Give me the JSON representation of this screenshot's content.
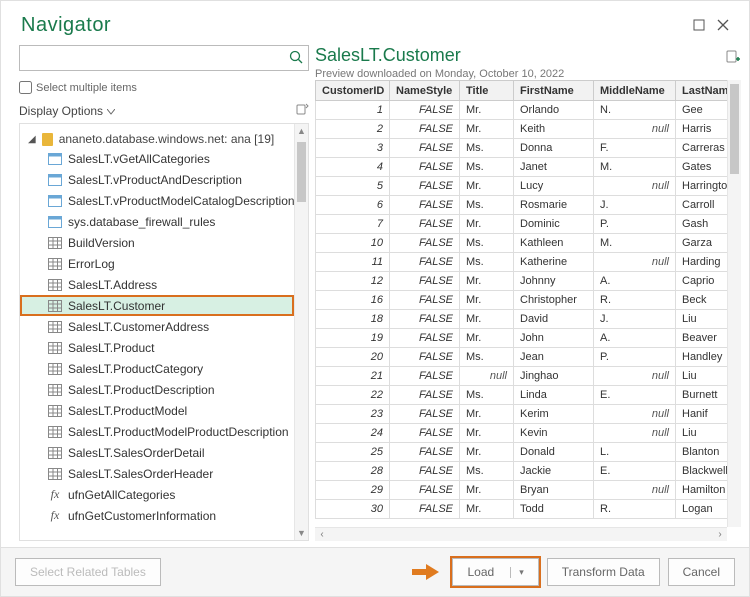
{
  "window": {
    "title": "Navigator"
  },
  "left": {
    "search_placeholder": "",
    "select_multiple": "Select multiple items",
    "display_options": "Display Options",
    "root": {
      "label": "ananeto.database.windows.net: ana [19]"
    },
    "items": [
      {
        "icon": "view",
        "label": "SalesLT.vGetAllCategories"
      },
      {
        "icon": "view",
        "label": "SalesLT.vProductAndDescription"
      },
      {
        "icon": "view",
        "label": "SalesLT.vProductModelCatalogDescription"
      },
      {
        "icon": "view",
        "label": "sys.database_firewall_rules"
      },
      {
        "icon": "table",
        "label": "BuildVersion"
      },
      {
        "icon": "table",
        "label": "ErrorLog"
      },
      {
        "icon": "table",
        "label": "SalesLT.Address"
      },
      {
        "icon": "table",
        "label": "SalesLT.Customer",
        "selected": true
      },
      {
        "icon": "table",
        "label": "SalesLT.CustomerAddress"
      },
      {
        "icon": "table",
        "label": "SalesLT.Product"
      },
      {
        "icon": "table",
        "label": "SalesLT.ProductCategory"
      },
      {
        "icon": "table",
        "label": "SalesLT.ProductDescription"
      },
      {
        "icon": "table",
        "label": "SalesLT.ProductModel"
      },
      {
        "icon": "table",
        "label": "SalesLT.ProductModelProductDescription"
      },
      {
        "icon": "table",
        "label": "SalesLT.SalesOrderDetail"
      },
      {
        "icon": "table",
        "label": "SalesLT.SalesOrderHeader"
      },
      {
        "icon": "fx",
        "label": "ufnGetAllCategories"
      },
      {
        "icon": "fx",
        "label": "ufnGetCustomerInformation"
      }
    ]
  },
  "right": {
    "title": "SalesLT.Customer",
    "subtitle": "Preview downloaded on Monday, October 10, 2022",
    "columns": [
      "CustomerID",
      "NameStyle",
      "Title",
      "FirstName",
      "MiddleName",
      "LastName"
    ],
    "rows": [
      {
        "id": 1,
        "ns": "FALSE",
        "t": "Mr.",
        "fn": "Orlando",
        "mn": "N.",
        "ln": "Gee"
      },
      {
        "id": 2,
        "ns": "FALSE",
        "t": "Mr.",
        "fn": "Keith",
        "mn": null,
        "ln": "Harris"
      },
      {
        "id": 3,
        "ns": "FALSE",
        "t": "Ms.",
        "fn": "Donna",
        "mn": "F.",
        "ln": "Carreras"
      },
      {
        "id": 4,
        "ns": "FALSE",
        "t": "Ms.",
        "fn": "Janet",
        "mn": "M.",
        "ln": "Gates"
      },
      {
        "id": 5,
        "ns": "FALSE",
        "t": "Mr.",
        "fn": "Lucy",
        "mn": null,
        "ln": "Harringto"
      },
      {
        "id": 6,
        "ns": "FALSE",
        "t": "Ms.",
        "fn": "Rosmarie",
        "mn": "J.",
        "ln": "Carroll"
      },
      {
        "id": 7,
        "ns": "FALSE",
        "t": "Mr.",
        "fn": "Dominic",
        "mn": "P.",
        "ln": "Gash"
      },
      {
        "id": 10,
        "ns": "FALSE",
        "t": "Ms.",
        "fn": "Kathleen",
        "mn": "M.",
        "ln": "Garza"
      },
      {
        "id": 11,
        "ns": "FALSE",
        "t": "Ms.",
        "fn": "Katherine",
        "mn": null,
        "ln": "Harding"
      },
      {
        "id": 12,
        "ns": "FALSE",
        "t": "Mr.",
        "fn": "Johnny",
        "mn": "A.",
        "ln": "Caprio"
      },
      {
        "id": 16,
        "ns": "FALSE",
        "t": "Mr.",
        "fn": "Christopher",
        "mn": "R.",
        "ln": "Beck"
      },
      {
        "id": 18,
        "ns": "FALSE",
        "t": "Mr.",
        "fn": "David",
        "mn": "J.",
        "ln": "Liu"
      },
      {
        "id": 19,
        "ns": "FALSE",
        "t": "Mr.",
        "fn": "John",
        "mn": "A.",
        "ln": "Beaver"
      },
      {
        "id": 20,
        "ns": "FALSE",
        "t": "Ms.",
        "fn": "Jean",
        "mn": "P.",
        "ln": "Handley"
      },
      {
        "id": 21,
        "ns": "FALSE",
        "t": null,
        "fn": "Jinghao",
        "mn": null,
        "ln": "Liu"
      },
      {
        "id": 22,
        "ns": "FALSE",
        "t": "Ms.",
        "fn": "Linda",
        "mn": "E.",
        "ln": "Burnett"
      },
      {
        "id": 23,
        "ns": "FALSE",
        "t": "Mr.",
        "fn": "Kerim",
        "mn": null,
        "ln": "Hanif"
      },
      {
        "id": 24,
        "ns": "FALSE",
        "t": "Mr.",
        "fn": "Kevin",
        "mn": null,
        "ln": "Liu"
      },
      {
        "id": 25,
        "ns": "FALSE",
        "t": "Mr.",
        "fn": "Donald",
        "mn": "L.",
        "ln": "Blanton"
      },
      {
        "id": 28,
        "ns": "FALSE",
        "t": "Ms.",
        "fn": "Jackie",
        "mn": "E.",
        "ln": "Blackwell"
      },
      {
        "id": 29,
        "ns": "FALSE",
        "t": "Mr.",
        "fn": "Bryan",
        "mn": null,
        "ln": "Hamilton"
      },
      {
        "id": 30,
        "ns": "FALSE",
        "t": "Mr.",
        "fn": "Todd",
        "mn": "R.",
        "ln": "Logan"
      }
    ]
  },
  "footer": {
    "select_related": "Select Related Tables",
    "load": "Load",
    "transform": "Transform Data",
    "cancel": "Cancel"
  },
  "misc": {
    "null_text": "null"
  }
}
